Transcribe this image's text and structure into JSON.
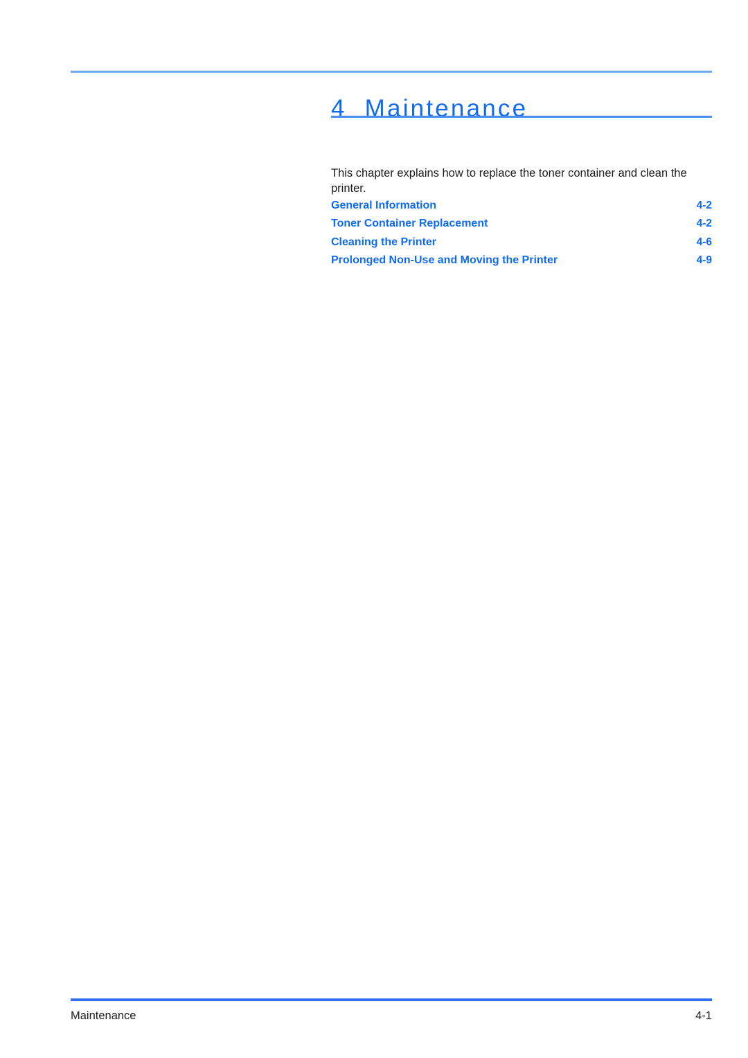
{
  "document": {
    "chapter_number": "4",
    "chapter_title": "Maintenance",
    "intro_paragraph": "This chapter explains how to replace the toner container and clean the printer.",
    "accent_color": "#0f6bf0",
    "rule_top_color": "#6fa8f5",
    "rule_bottom_color": "#4a8cf0",
    "footer_rule_color": "#2f6ff2"
  },
  "toc": {
    "entries": [
      {
        "label": "General Information",
        "page": "4-2"
      },
      {
        "label": "Toner Container Replacement",
        "page": "4-2"
      },
      {
        "label": "Cleaning the Printer",
        "page": "4-6"
      },
      {
        "label": "Prolonged Non-Use and Moving the Printer",
        "page": "4-9"
      }
    ]
  },
  "footer": {
    "section_name": "Maintenance",
    "page_number": "4-1"
  }
}
